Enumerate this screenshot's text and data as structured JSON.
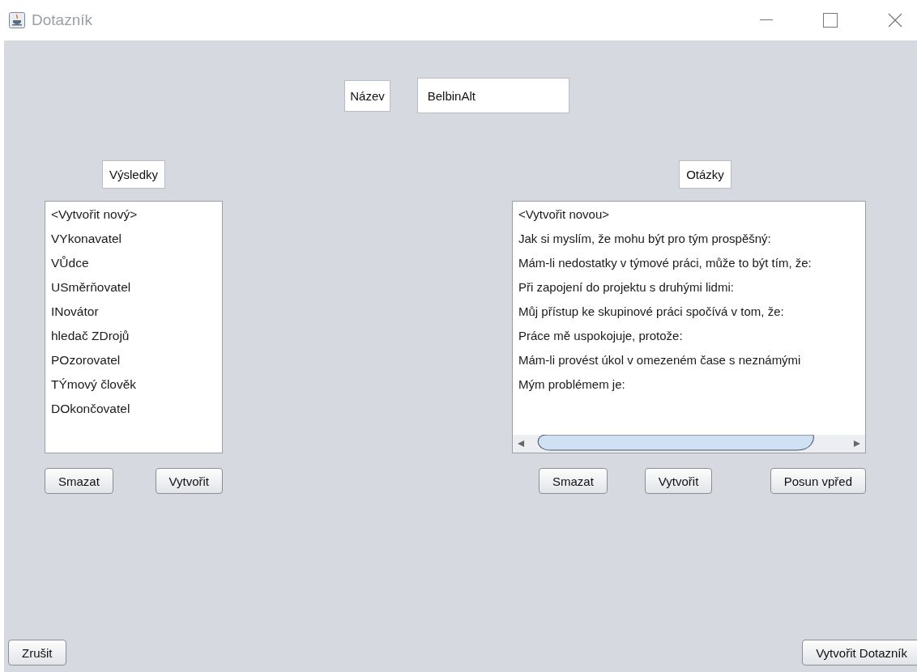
{
  "window": {
    "title": "Dotazník"
  },
  "name": {
    "label": "Název",
    "value": "BelbinAlt"
  },
  "results": {
    "label": "Výsledky",
    "items": [
      "<Vytvořit nový>",
      "VYkonavatel",
      "VŮdce",
      "USměrňovatel",
      "INovátor",
      "hledač ZDrojů",
      "POzorovatel",
      "TÝmový člověk",
      "DOkončovatel"
    ],
    "buttons": [
      "Smazat",
      "Vytvořit"
    ]
  },
  "questions": {
    "label": "Otázky",
    "items": [
      "<Vytvořit novou>",
      "Jak si myslím, že mohu být pro tým prospěšný:",
      "Mám-li nedostatky v týmové práci, může to být tím, že:",
      "Při zapojení do projektu s druhými lidmi:",
      "Můj přístup ke skupinové práci spočívá v tom, že:",
      "Práce mě uspokojuje, protože:",
      "Mám-li provést úkol v omezeném čase s neznámými",
      "Mým problémem je:"
    ],
    "buttons": [
      "Smazat",
      "Vytvořit",
      "Posun vpřed"
    ]
  },
  "footer": {
    "buttons": [
      "Zrušit",
      "Vytvořit Dotazník"
    ]
  }
}
